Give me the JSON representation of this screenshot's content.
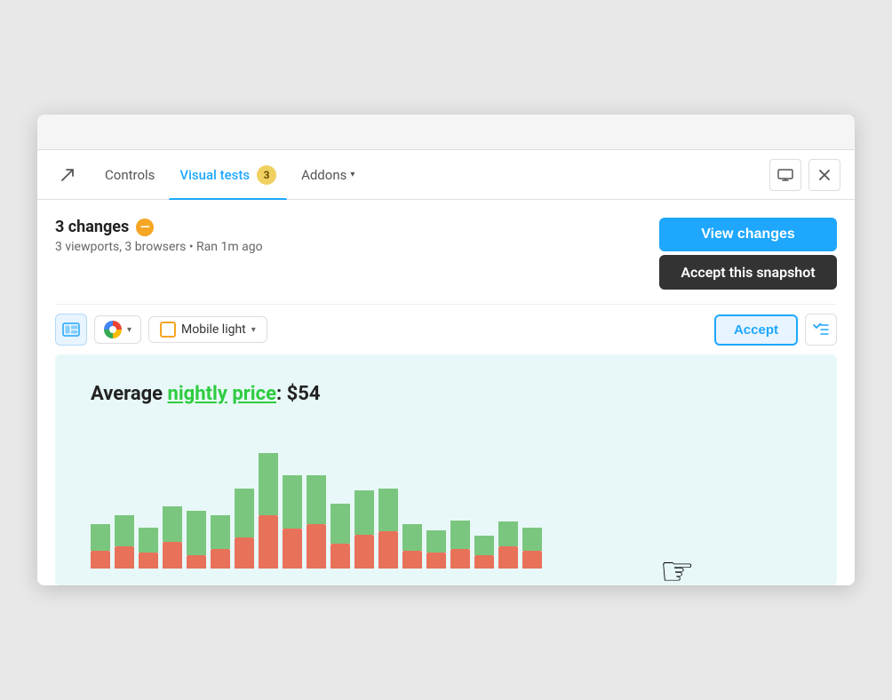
{
  "tabs": {
    "external_icon": "↗",
    "items": [
      {
        "id": "controls",
        "label": "Controls",
        "active": false
      },
      {
        "id": "visual-tests",
        "label": "Visual tests",
        "active": true,
        "badge": "3"
      },
      {
        "id": "addons",
        "label": "Addons",
        "active": false,
        "has_dropdown": true
      }
    ],
    "icons": {
      "monitor": "⊟",
      "close": "✕"
    }
  },
  "changes": {
    "count": "3 changes",
    "subtitle": "3 viewports, 3 browsers • Ran 1m ago",
    "btn_view_changes": "View changes",
    "tooltip_accept": "Accept this snapshot"
  },
  "toolbar": {
    "snapshot_icon": "⊞",
    "browser_label": "",
    "viewport_label": "Mobile light",
    "chevron": "▾",
    "btn_accept": "Accept",
    "btn_checklist_icon": "✓≡"
  },
  "preview": {
    "title_prefix": "Average nightly price: $54",
    "highlight_words": [
      "nightly",
      "price"
    ]
  },
  "chart": {
    "bars": [
      {
        "red": 20,
        "green": 30
      },
      {
        "red": 25,
        "green": 35
      },
      {
        "red": 18,
        "green": 28
      },
      {
        "red": 30,
        "green": 40
      },
      {
        "red": 15,
        "green": 50
      },
      {
        "red": 22,
        "green": 38
      },
      {
        "red": 35,
        "green": 55
      },
      {
        "red": 60,
        "green": 70
      },
      {
        "red": 45,
        "green": 60
      },
      {
        "red": 50,
        "green": 55
      },
      {
        "red": 28,
        "green": 45
      },
      {
        "red": 38,
        "green": 50
      },
      {
        "red": 42,
        "green": 48
      },
      {
        "red": 20,
        "green": 30
      },
      {
        "red": 18,
        "green": 25
      },
      {
        "red": 22,
        "green": 32
      },
      {
        "red": 15,
        "green": 22
      },
      {
        "red": 25,
        "green": 28
      },
      {
        "red": 20,
        "green": 26
      }
    ]
  }
}
